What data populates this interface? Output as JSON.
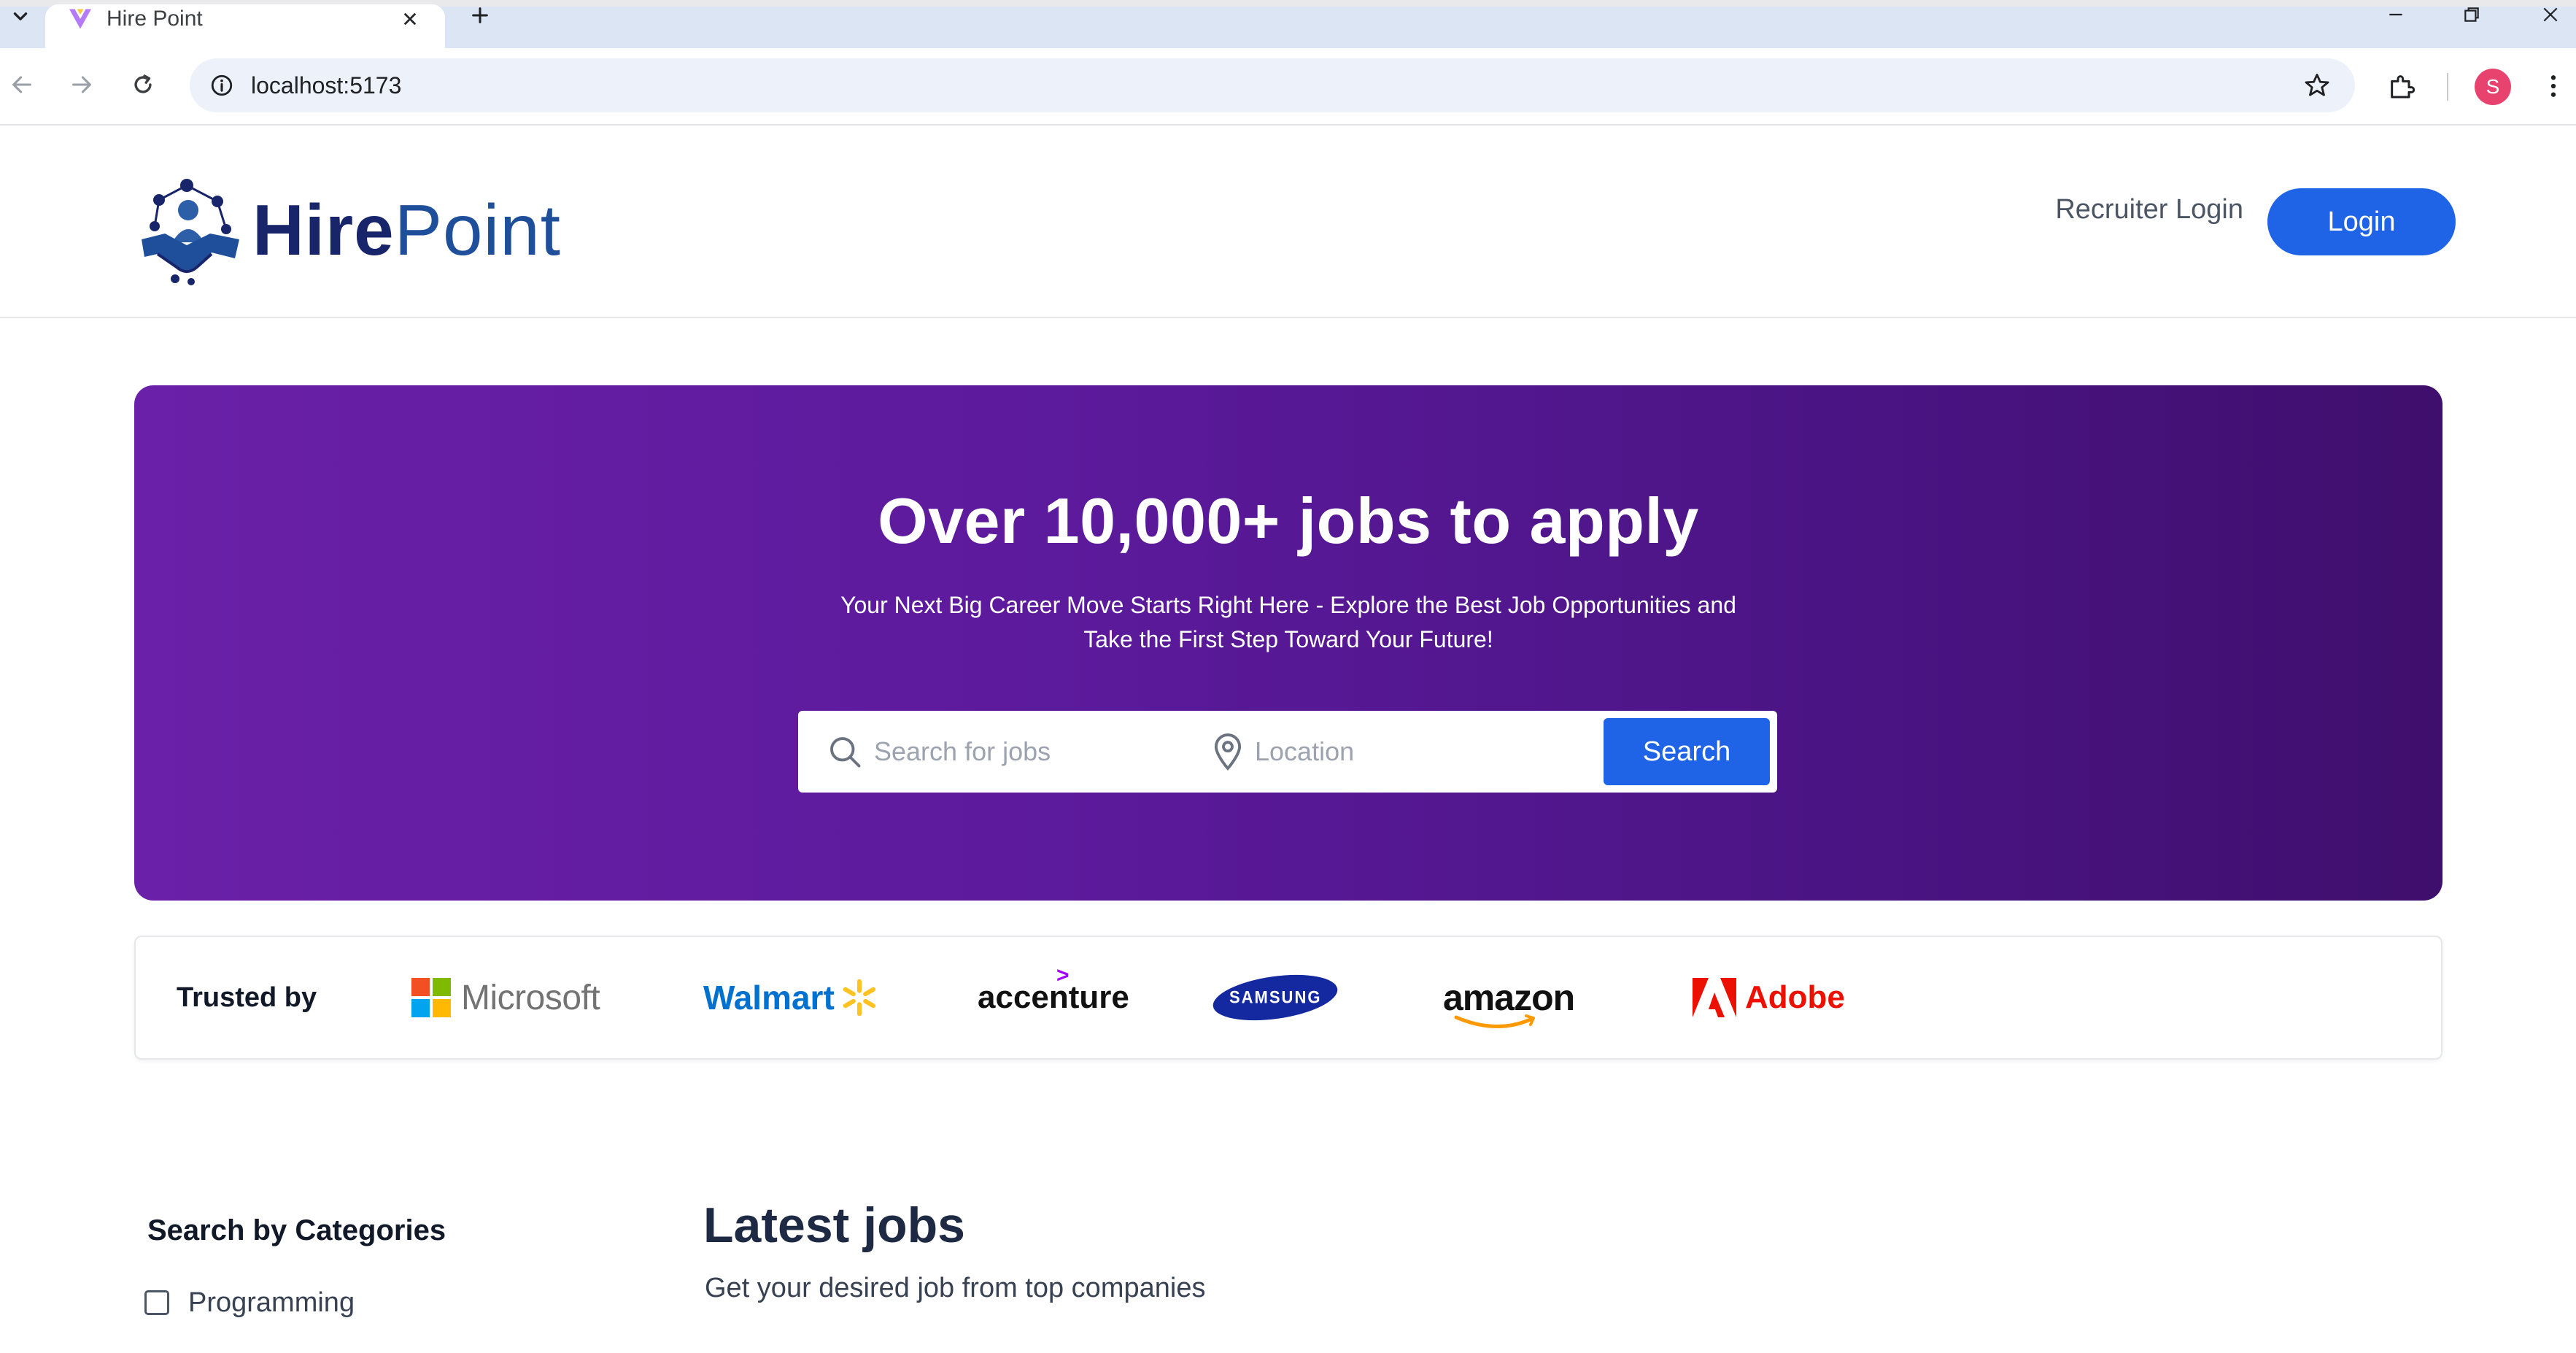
{
  "browser": {
    "tab_title": "Hire Point",
    "url": "localhost:5173",
    "profile_initial": "S"
  },
  "header": {
    "logo_hire": "Hire",
    "logo_point": "Point",
    "recruiter_login": "Recruiter Login",
    "login": "Login"
  },
  "hero": {
    "title": "Over 10,000+ jobs to apply",
    "subtitle_line1": "Your Next Big Career Move Starts Right Here - Explore the Best Job Opportunities and",
    "subtitle_line2": "Take the First Step Toward Your Future!",
    "search_placeholder": "Search for jobs",
    "location_placeholder": "Location",
    "search_button": "Search"
  },
  "trusted": {
    "label": "Trusted by",
    "brands": {
      "microsoft": "Microsoft",
      "walmart": "Walmart",
      "accenture": "accenture",
      "samsung": "SAMSUNG",
      "amazon": "amazon",
      "adobe": "Adobe"
    }
  },
  "categories": {
    "title": "Search by Categories",
    "items": [
      {
        "label": "Programming",
        "checked": false
      }
    ]
  },
  "latest_jobs": {
    "title": "Latest jobs",
    "subtitle": "Get your desired job from top companies"
  },
  "colors": {
    "primary": "#1f64e6",
    "hero_start": "#6a20a8",
    "hero_end": "#3f0f6d",
    "logo_navy": "#18256b"
  },
  "icons": [
    "chevron-down-icon",
    "favicon-icon",
    "close-icon",
    "plus-icon",
    "back-icon",
    "forward-icon",
    "reload-icon",
    "info-icon",
    "star-icon",
    "extensions-icon",
    "kebab-menu-icon",
    "search-icon",
    "location-pin-icon"
  ]
}
